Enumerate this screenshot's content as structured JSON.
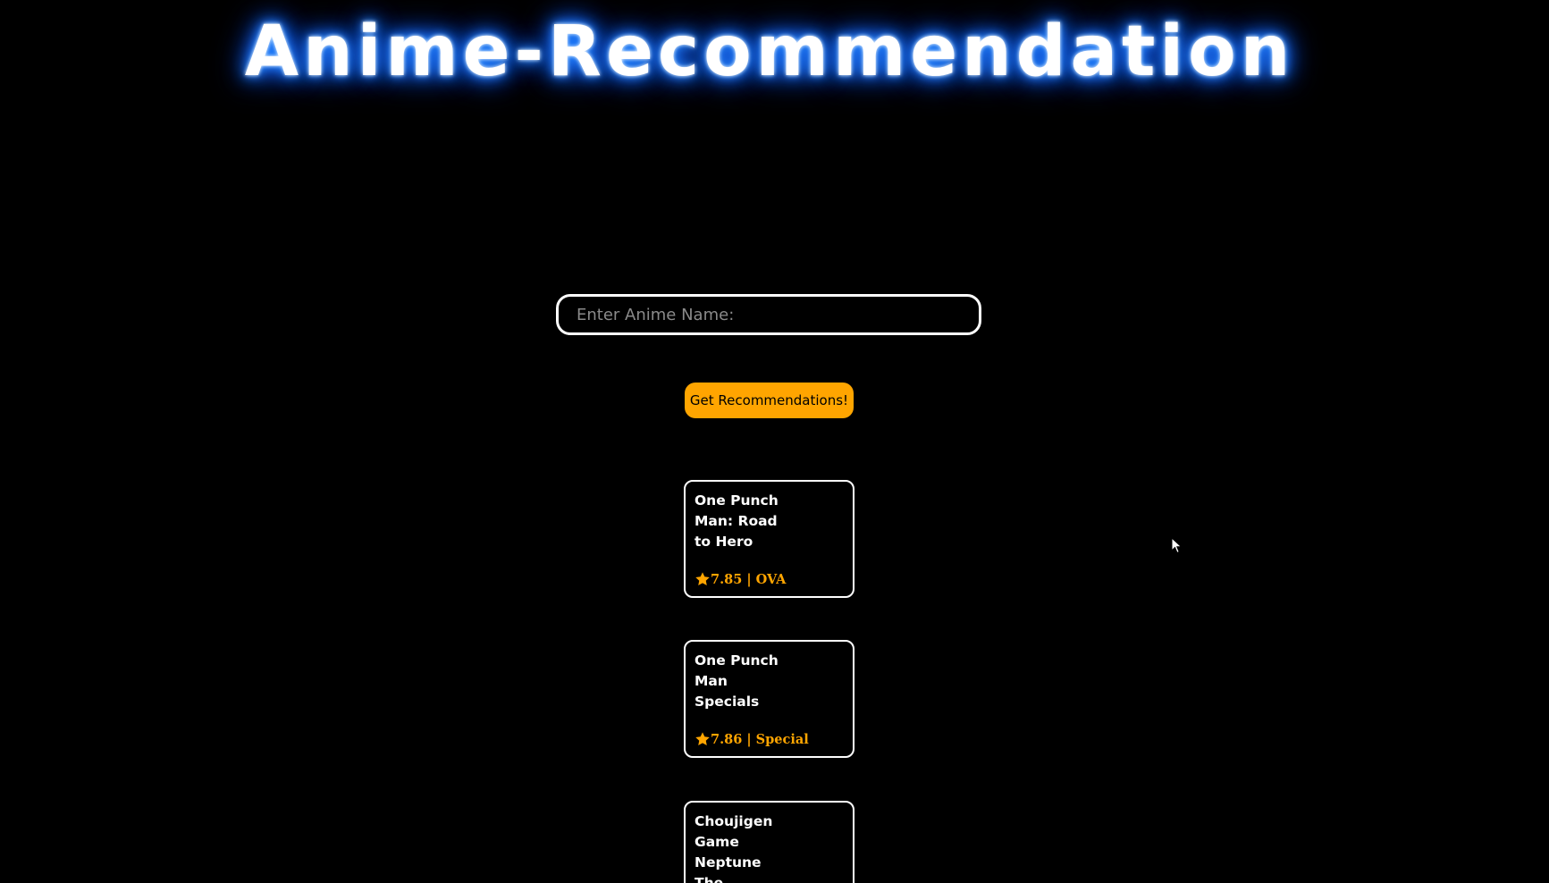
{
  "header": {
    "title": "Anime-Recommendation"
  },
  "search": {
    "placeholder": "Enter Anime Name:",
    "value": ""
  },
  "action": {
    "button_label": "Get Recommendations!"
  },
  "results": [
    {
      "title": "One Punch Man: Road to Hero",
      "meta": "7.85 | OVA"
    },
    {
      "title": "One Punch Man Specials",
      "meta": "7.86 | Special"
    },
    {
      "title": "Choujigen Game Neptune The Animation",
      "meta": ""
    }
  ],
  "colors": {
    "background": "#000000",
    "title_glow": "#1e7bff",
    "accent": "#ffa500",
    "border": "#ffffff"
  },
  "icons": {
    "rating": "star-icon",
    "pointer": "cursor-icon"
  }
}
